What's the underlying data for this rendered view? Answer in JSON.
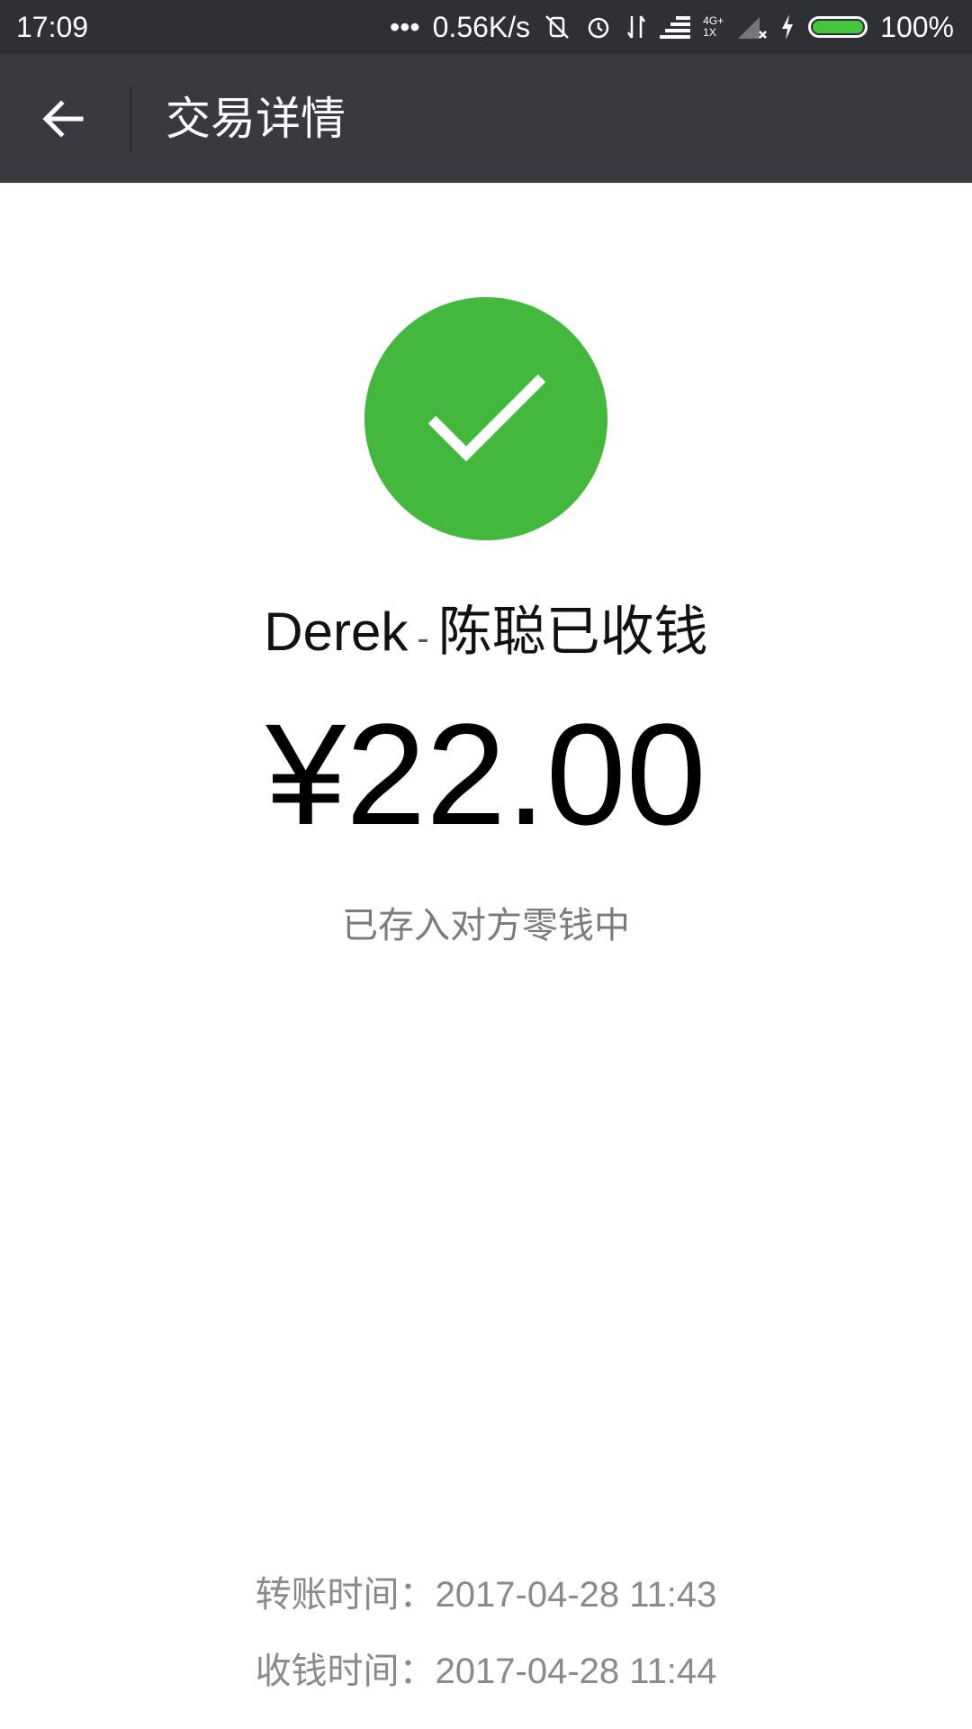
{
  "status_bar": {
    "time": "17:09",
    "dots": "•••",
    "network_speed": "0.56K/s",
    "network_type_top": "4G+",
    "network_type_bottom": "1X",
    "battery_percent": "100%",
    "battery_level": 1.0,
    "battery_color": "#45c53b",
    "icons": [
      "mute-vibrate-icon",
      "alarm-icon",
      "data-transfer-icon",
      "signal-icon",
      "signal-off-icon",
      "charging-icon",
      "battery-icon"
    ]
  },
  "nav": {
    "title": "交易详情",
    "back_icon": "arrow-left-icon"
  },
  "main": {
    "success_icon": "check-icon",
    "success_color": "#43b83c",
    "receiver_name": "Derek",
    "receiver_separator": "-",
    "receiver_suffix": "陈聪已收钱",
    "amount": "¥22.00",
    "status_text": "已存入对方零钱中"
  },
  "footer": {
    "transfer_time_label": "转账时间：",
    "transfer_time": "2017-04-28 11:43",
    "receive_time_label": "收钱时间：",
    "receive_time": "2017-04-28 11:44"
  }
}
